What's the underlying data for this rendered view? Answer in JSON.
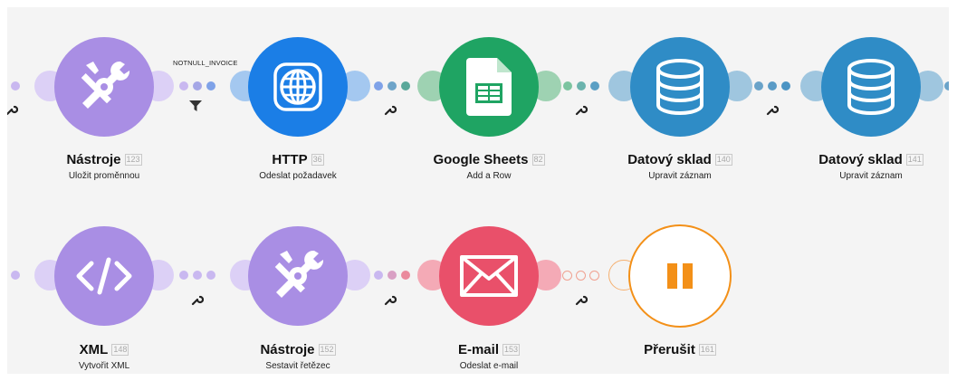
{
  "filter": {
    "label": "NOTNULL_INVOICE"
  },
  "modules": [
    {
      "name": "Nástroje",
      "id": "123",
      "subtitle": "Uložit proměnnou",
      "color": "#a98ee4",
      "icon": "tools-icon"
    },
    {
      "name": "HTTP",
      "id": "36",
      "subtitle": "Odeslat požadavek",
      "color": "#1b7ee6",
      "icon": "globe-icon"
    },
    {
      "name": "Google Sheets",
      "id": "82",
      "subtitle": "Add a Row",
      "color": "#1fa463",
      "icon": "sheets-icon"
    },
    {
      "name": "Datový sklad",
      "id": "140",
      "subtitle": "Upravit záznam",
      "color": "#2f8cc6",
      "icon": "database-icon"
    },
    {
      "name": "Datový sklad",
      "id": "141",
      "subtitle": "Upravit záznam",
      "color": "#2f8cc6",
      "icon": "database-icon"
    },
    {
      "name": "XML",
      "id": "148",
      "subtitle": "Vytvořit XML",
      "color": "#a98ee4",
      "icon": "code-icon"
    },
    {
      "name": "Nástroje",
      "id": "152",
      "subtitle": "Sestavit řetězec",
      "color": "#a98ee4",
      "icon": "tools-icon"
    },
    {
      "name": "E-mail",
      "id": "153",
      "subtitle": "Odeslat e-mail",
      "color": "#e9506a",
      "icon": "envelope-icon"
    },
    {
      "name": "Přerušit",
      "id": "161",
      "subtitle": "",
      "color": "#f39018",
      "icon": "pause-icon"
    }
  ]
}
